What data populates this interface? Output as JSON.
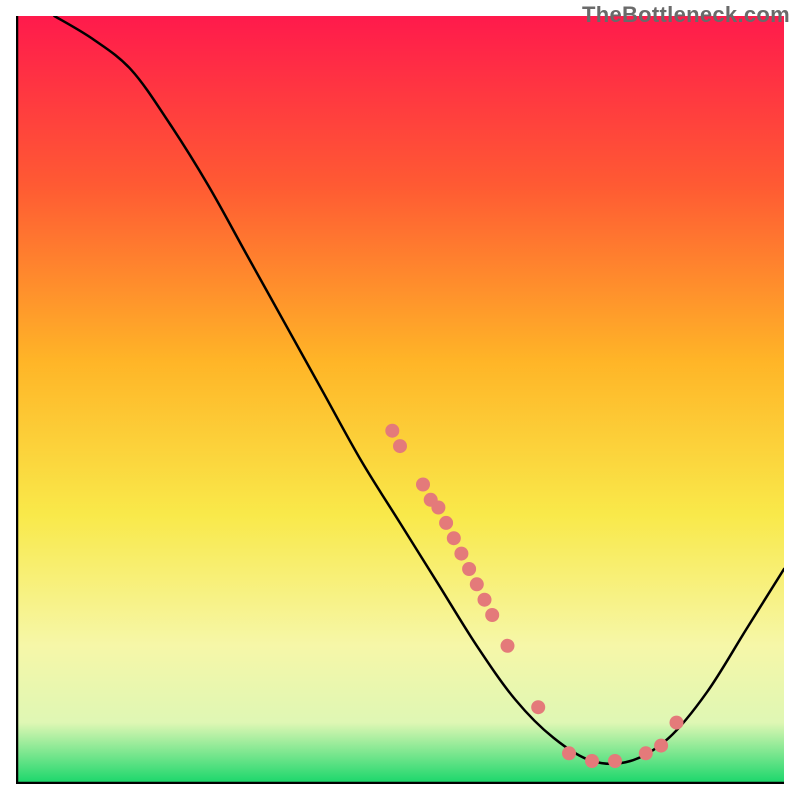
{
  "watermark": "TheBottleneck.com",
  "colors": {
    "gradient_top": "#ff1a4c",
    "gradient_mid1": "#ff8a2a",
    "gradient_mid2": "#f9e94a",
    "gradient_mid3": "#f3f9b0",
    "gradient_bottom": "#17d66a",
    "axis": "#000000",
    "curve": "#000000",
    "dot": "#e47a7a"
  },
  "chart_data": {
    "type": "line",
    "title": "",
    "xlabel": "",
    "ylabel": "",
    "xlim": [
      0,
      100
    ],
    "ylim": [
      0,
      100
    ],
    "curve": [
      {
        "x": 5,
        "y": 100
      },
      {
        "x": 10,
        "y": 97
      },
      {
        "x": 15,
        "y": 93
      },
      {
        "x": 20,
        "y": 86
      },
      {
        "x": 25,
        "y": 78
      },
      {
        "x": 30,
        "y": 69
      },
      {
        "x": 35,
        "y": 60
      },
      {
        "x": 40,
        "y": 51
      },
      {
        "x": 45,
        "y": 42
      },
      {
        "x": 50,
        "y": 34
      },
      {
        "x": 55,
        "y": 26
      },
      {
        "x": 60,
        "y": 18
      },
      {
        "x": 65,
        "y": 11
      },
      {
        "x": 70,
        "y": 6
      },
      {
        "x": 75,
        "y": 3
      },
      {
        "x": 80,
        "y": 3
      },
      {
        "x": 85,
        "y": 6
      },
      {
        "x": 90,
        "y": 12
      },
      {
        "x": 95,
        "y": 20
      },
      {
        "x": 100,
        "y": 28
      }
    ],
    "points": [
      {
        "x": 49,
        "y": 46
      },
      {
        "x": 50,
        "y": 44
      },
      {
        "x": 53,
        "y": 39
      },
      {
        "x": 54,
        "y": 37
      },
      {
        "x": 55,
        "y": 36
      },
      {
        "x": 56,
        "y": 34
      },
      {
        "x": 57,
        "y": 32
      },
      {
        "x": 58,
        "y": 30
      },
      {
        "x": 59,
        "y": 28
      },
      {
        "x": 60,
        "y": 26
      },
      {
        "x": 61,
        "y": 24
      },
      {
        "x": 62,
        "y": 22
      },
      {
        "x": 64,
        "y": 18
      },
      {
        "x": 68,
        "y": 10
      },
      {
        "x": 72,
        "y": 4
      },
      {
        "x": 75,
        "y": 3
      },
      {
        "x": 78,
        "y": 3
      },
      {
        "x": 82,
        "y": 4
      },
      {
        "x": 84,
        "y": 5
      },
      {
        "x": 86,
        "y": 8
      }
    ]
  }
}
